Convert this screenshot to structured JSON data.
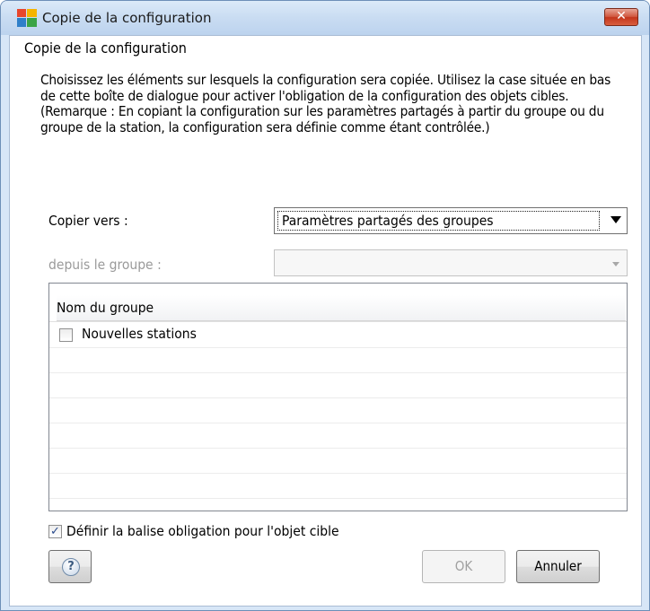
{
  "window": {
    "title": "Copie de la configuration",
    "close_label": "✕"
  },
  "dialog": {
    "heading": "Copie de la configuration",
    "description": "Choisissez les éléments sur lesquels la configuration sera copiée. Utilisez la case située en bas de cette boîte de dialogue pour activer l'obligation de la configuration des objets cibles. (Remarque : En copiant la configuration sur les paramètres partagés à partir du groupe ou du groupe de la station, la configuration sera définie comme étant contrôlée.)",
    "copy_to": {
      "label": "Copier vers :",
      "selected_value": "Paramètres partagés des groupes"
    },
    "from_group": {
      "label": "depuis le groupe :",
      "selected_value": ""
    },
    "group_table": {
      "column_header": "Nom du groupe",
      "rows": [
        {
          "label": "Nouvelles stations",
          "checked": false
        }
      ]
    },
    "mandatory_flag": {
      "label": "Définir la balise obligation pour l'objet cible",
      "checked": true,
      "check_glyph": "✓"
    },
    "buttons": {
      "help_glyph": "?",
      "ok_label": "OK",
      "cancel_label": "Annuler"
    }
  },
  "colors": {
    "close_button": "#c3351c",
    "disabled_text": "#9a9a9a"
  }
}
